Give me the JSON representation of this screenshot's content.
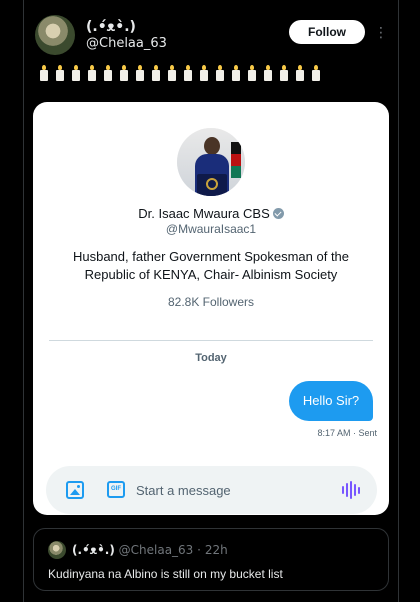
{
  "tweet": {
    "author_name": "(.•́ᴥ•̀.)",
    "author_handle": "@Chelaa_63",
    "follow_label": "Follow",
    "more_icon": "more-vertical-icon",
    "candle_count": 18
  },
  "dm_card": {
    "profile_name": "Dr. Isaac Mwaura CBS",
    "verified_icon": "verified-badge-icon",
    "profile_handle": "@MwauraIsaac1",
    "bio": "Husband, father Government Spokesman of the Republic of KENYA, Chair- Albinism Society",
    "followers": "82.8K Followers",
    "day_label": "Today",
    "messages": [
      {
        "text": "Hello Sir?",
        "meta": "8:17 AM · Sent"
      }
    ],
    "composer": {
      "placeholder": "Start a message",
      "media_icon": "image-icon",
      "gif_icon": "gif-icon",
      "gif_text": "GIF",
      "voice_icon": "voice-message-icon"
    }
  },
  "quoted_reply": {
    "author_name": "(.•́ᴥ•̀.)",
    "author_handle": "@Chelaa_63",
    "time": "22h",
    "separator": "·",
    "text": "Kudinyana na Albino is still on my bucket list"
  },
  "colors": {
    "accent": "#1d9bf0",
    "voice": "#7856ff",
    "background": "#000000"
  }
}
